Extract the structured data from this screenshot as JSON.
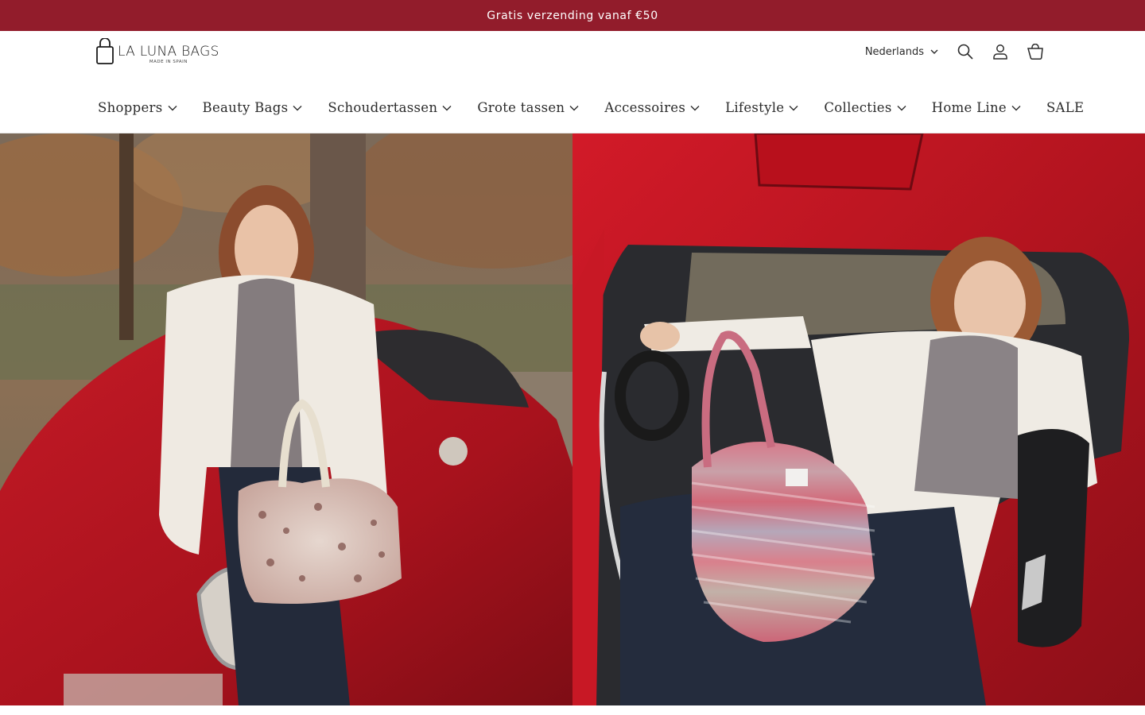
{
  "announcement": {
    "text": "Gratis verzending vanaf €50"
  },
  "logo": {
    "name": "LA LUNA BAGS",
    "tagline": "MADE IN SPAIN"
  },
  "header": {
    "language": "Nederlands",
    "icons": [
      "search-icon",
      "account-icon",
      "cart-icon"
    ]
  },
  "nav": {
    "items": [
      {
        "label": "Shoppers"
      },
      {
        "label": "Beauty Bags"
      },
      {
        "label": "Schoudertassen"
      },
      {
        "label": "Grote tassen"
      },
      {
        "label": "Accessoires"
      },
      {
        "label": "Lifestyle"
      },
      {
        "label": "Collecties"
      },
      {
        "label": "Home Line"
      },
      {
        "label": "SALE"
      }
    ]
  },
  "colors": {
    "announcement_bg": "#921c2b",
    "text": "#2b2b2b",
    "car_red": "#b3141f"
  }
}
